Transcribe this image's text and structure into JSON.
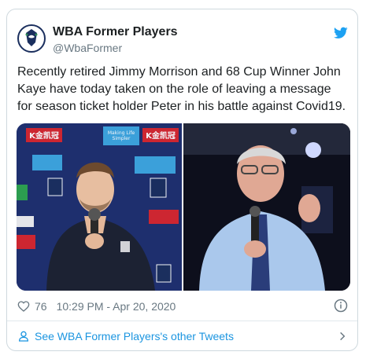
{
  "tweet": {
    "author_name": "WBA Former Players",
    "author_handle": "@WbaFormer",
    "text": "Recently retired Jimmy Morrison and 68 Cup Winner John Kaye have today taken on the role of leaving a message for season ticket holder Peter in his battle against Covid19.",
    "likes": "76",
    "timestamp": "10:29 PM - Apr 20, 2020",
    "footer_link": "See WBA Former Players's other Tweets"
  },
  "icons": {
    "platform": "bird-icon",
    "like": "heart-icon",
    "info": "info-icon",
    "profile": "person-icon",
    "next": "chevron-right-icon"
  },
  "colors": {
    "link": "#1b95e0",
    "muted": "#697882",
    "text": "#1c2022",
    "border": "#cfd9de"
  },
  "media_sponsor_text": [
    "K金凯冠",
    "Making Life Simpler"
  ]
}
